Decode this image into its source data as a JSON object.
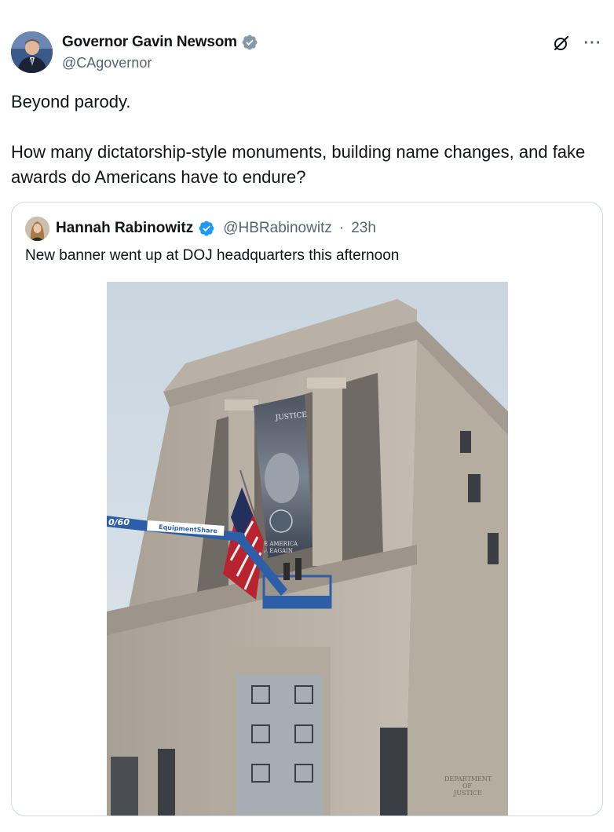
{
  "tweet": {
    "author_name": "Governor Gavin Newsom",
    "author_handle": "@CAgovernor",
    "text": "Beyond parody.\n\nHow many dictatorship-style monuments, building name changes, and fake awards do Americans have to endure?",
    "verified_icon": "verified-badge-icon",
    "grok_icon": "grok-icon",
    "more_label": "···"
  },
  "quote": {
    "author_name": "Hannah Rabinowitz",
    "author_handle": "@HBRabinowitz",
    "separator": "·",
    "time": "23h",
    "text": "New banner went up at DOJ headquarters this afternoon",
    "image": {
      "banner_top": "JUSTICE",
      "banner_bottom_1": "E AMERICA",
      "banner_bottom_2": "A EAGAIN",
      "lift_number": "0/60",
      "lift_brand": "EquipmentShare",
      "plaque_1": "DEPARTMENT",
      "plaque_2": "OF",
      "plaque_3": "JUSTICE"
    }
  },
  "colors": {
    "verified_blue": "#1d9bf0",
    "secondary_text": "#536471",
    "border": "#cfd9de"
  }
}
